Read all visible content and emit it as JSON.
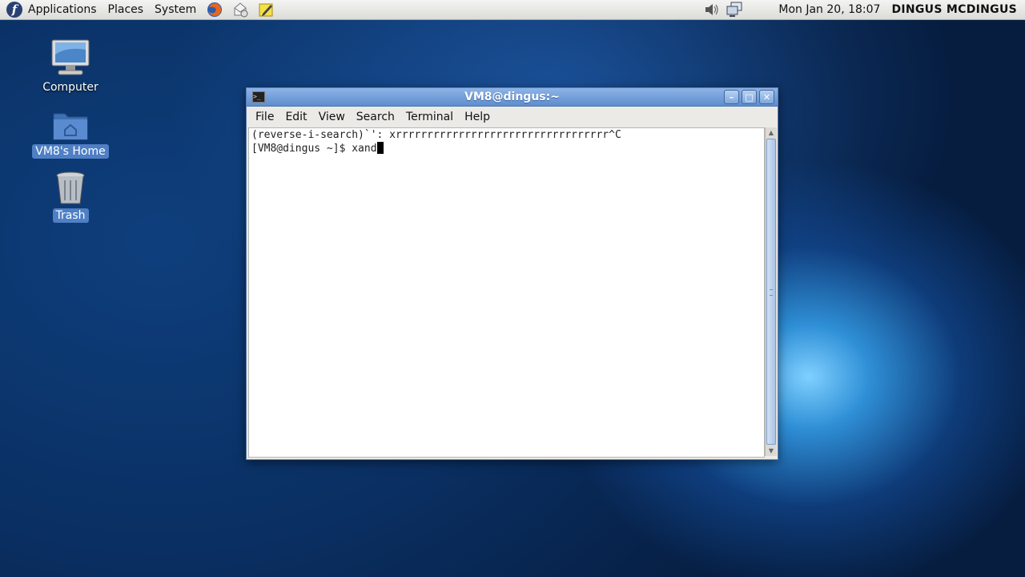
{
  "panel": {
    "menus": [
      "Applications",
      "Places",
      "System"
    ],
    "launchers": [
      "firefox-icon",
      "mail-icon",
      "notes-icon"
    ],
    "clock": "Mon Jan 20, 18:07",
    "user": "DINGUS MCDINGUS"
  },
  "desktop": {
    "icons": [
      {
        "label": "Computer",
        "icon": "computer-icon"
      },
      {
        "label": "VM8's Home",
        "icon": "home-folder-icon"
      },
      {
        "label": "Trash",
        "icon": "trash-icon"
      }
    ]
  },
  "terminal": {
    "title": "VM8@dingus:~",
    "menu": [
      "File",
      "Edit",
      "View",
      "Search",
      "Terminal",
      "Help"
    ],
    "lines": [
      "(reverse-i-search)`': xrrrrrrrrrrrrrrrrrrrrrrrrrrrrrrrrrr^C",
      "[VM8@dingus ~]$ xand"
    ]
  }
}
